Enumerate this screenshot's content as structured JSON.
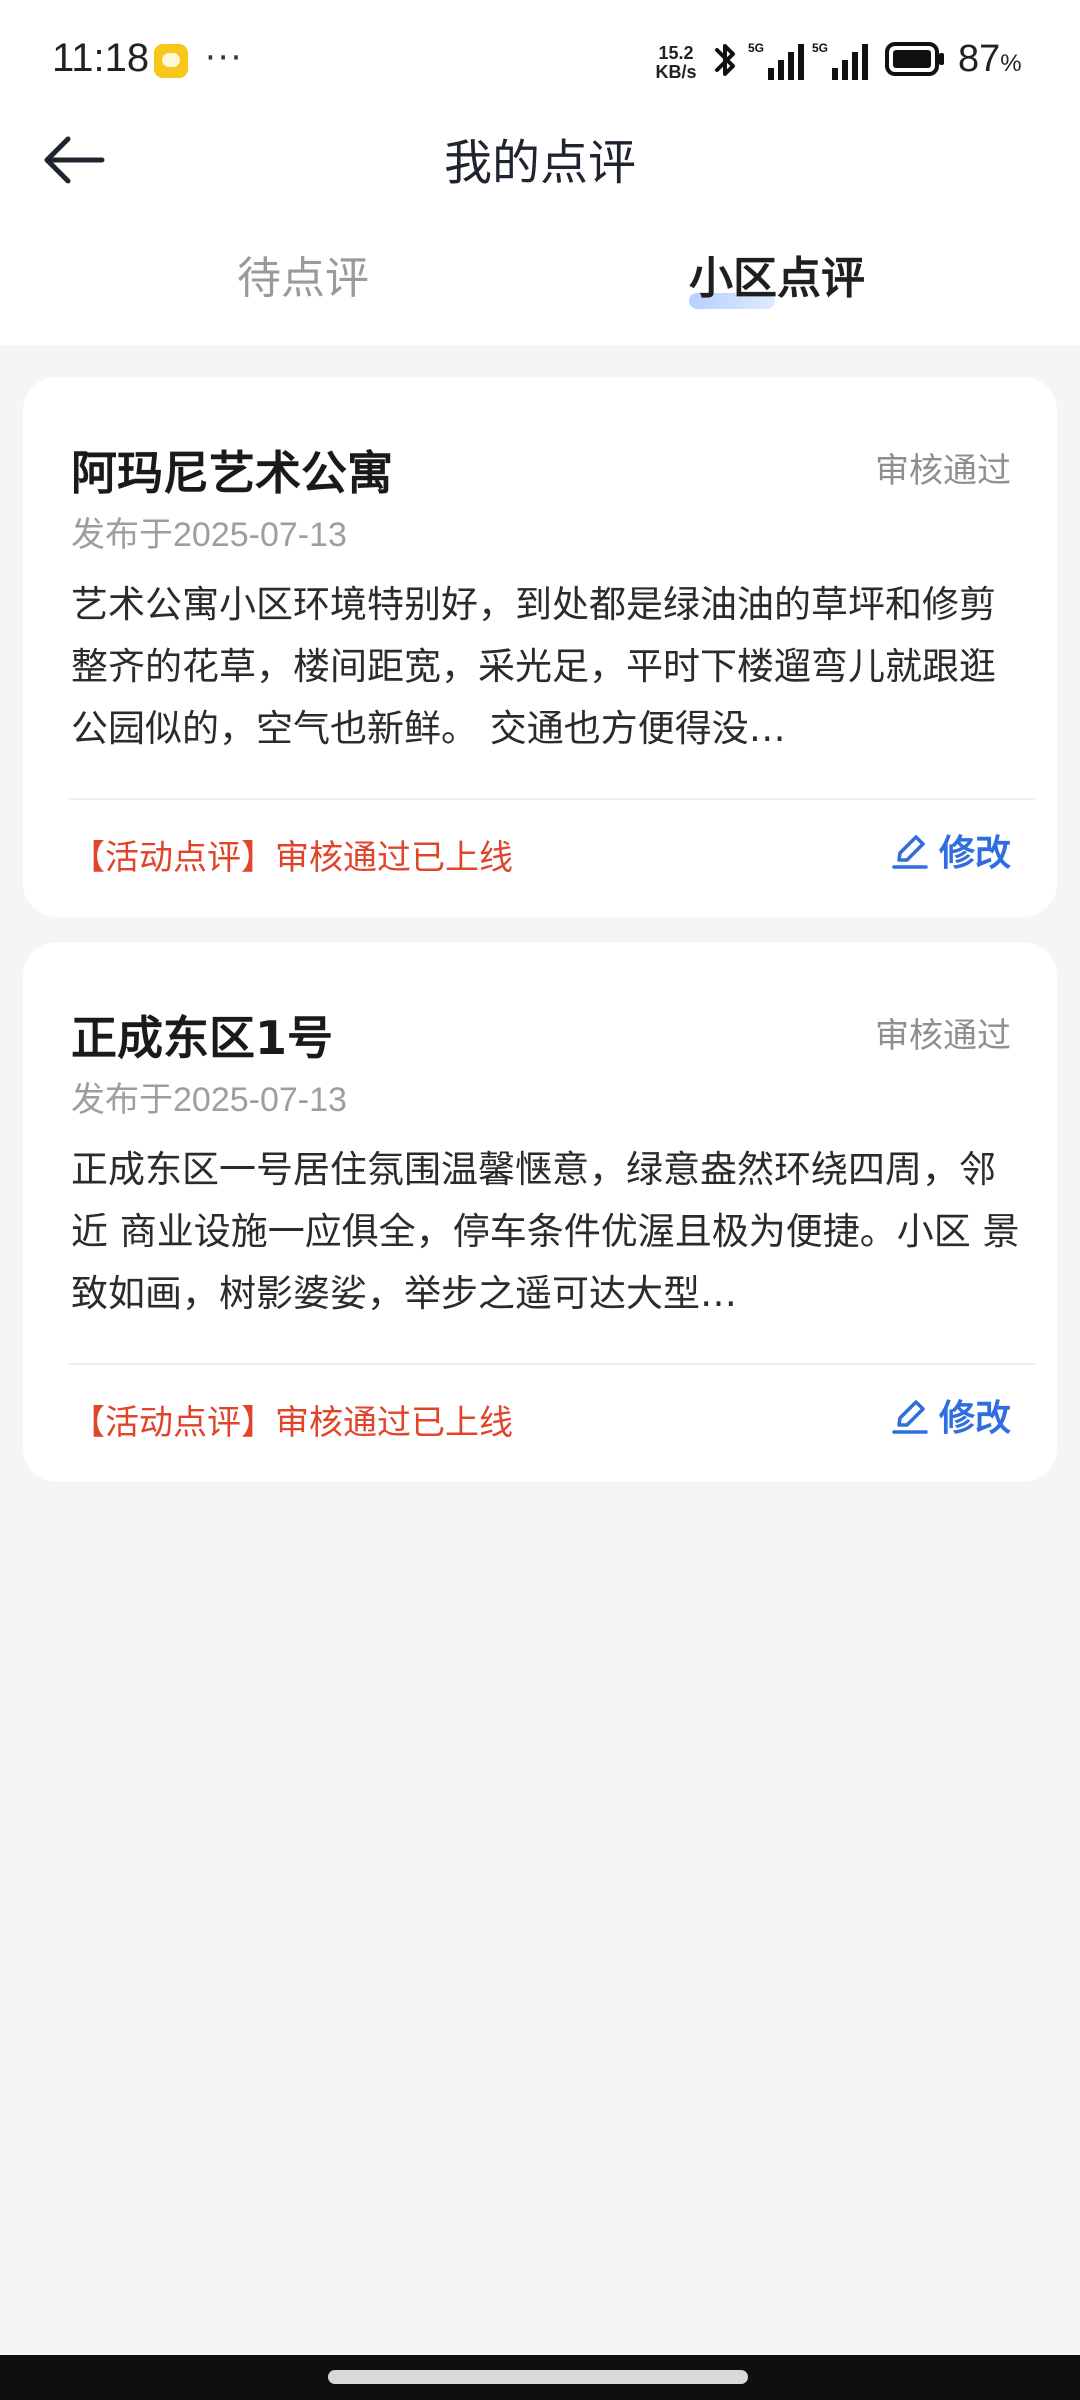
{
  "status_bar": {
    "time": "11:18",
    "net_speed_value": "15.2",
    "net_speed_unit": "KB/s",
    "network_1": "5G",
    "network_2": "5G",
    "battery": "87",
    "battery_unit": "%"
  },
  "header": {
    "title": "我的点评",
    "tabs": [
      {
        "label": "待点评",
        "active": false
      },
      {
        "label": "小区点评",
        "active": true
      }
    ]
  },
  "reviews": [
    {
      "title": "阿玛尼艺术公寓",
      "status": "审核通过",
      "date": "发布于2025-07-13",
      "body": "艺术公寓小区环境特别好，到处都是绿油油的草坪和修剪整齐的花草，楼间距宽，采光足，平时下楼遛弯儿就跟逛公园似的，空气也新鲜。 交通也方便得没…",
      "note": "【活动点评】审核通过已上线",
      "edit_label": "修改"
    },
    {
      "title": "正成东区1号",
      "status": "审核通过",
      "date": "发布于2025-07-13",
      "body": "正成东区一号居住氛围温馨惬意，绿意盎然环绕四周，邻近 商业设施一应俱全，停车条件优渥且极为便捷。小区 景致如画，树影婆娑，举步之遥可达大型…",
      "note": "【活动点评】审核通过已上线",
      "edit_label": "修改"
    }
  ],
  "colors": {
    "accent_blue": "#2f6de0",
    "note_red": "#e0442a",
    "background": "#f5f5f5"
  },
  "icons": [
    "back-arrow-icon",
    "bluetooth-icon",
    "signal-icon",
    "battery-icon",
    "edit-icon"
  ]
}
